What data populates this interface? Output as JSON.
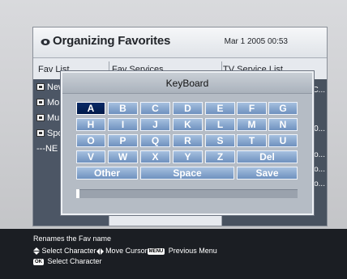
{
  "window": {
    "title": "Organizing Favorites",
    "date": "Mar 1 2005 00:53",
    "columns": [
      "Fav List",
      "Fav Services",
      "TV Service List"
    ]
  },
  "fav_list": [
    {
      "label": "New"
    },
    {
      "label": "Mo"
    },
    {
      "label": "Mu"
    },
    {
      "label": "Spo"
    },
    {
      "label": "---NE"
    }
  ],
  "right_list": [
    "C...",
    "0...",
    "o...",
    "o...",
    "o..."
  ],
  "keyboard": {
    "title": "KeyBoard",
    "rows": [
      [
        "A",
        "B",
        "C",
        "D",
        "E",
        "F",
        "G"
      ],
      [
        "H",
        "I",
        "J",
        "K",
        "L",
        "M",
        "N"
      ],
      [
        "O",
        "P",
        "Q",
        "R",
        "S",
        "T",
        "U"
      ],
      [
        "V",
        "W",
        "X",
        "Y",
        "Z"
      ]
    ],
    "del_label": "Del",
    "other_label": "Other",
    "space_label": "Space",
    "save_label": "Save",
    "selected_key": "A",
    "input_value": ""
  },
  "help": {
    "line1": "Renames the Fav name",
    "line2_a": "Select Character",
    "line2_b": "Move Cursor",
    "line2_c": "Previous Menu",
    "line3": "Select Character",
    "menu_icon": "MENU",
    "ok_icon": "OK"
  },
  "colors": {
    "key_fill": "#7f9fcb",
    "key_selected": "#001a4a",
    "panel_dark": "#4c5665",
    "help_bar": "#1b1e23"
  }
}
